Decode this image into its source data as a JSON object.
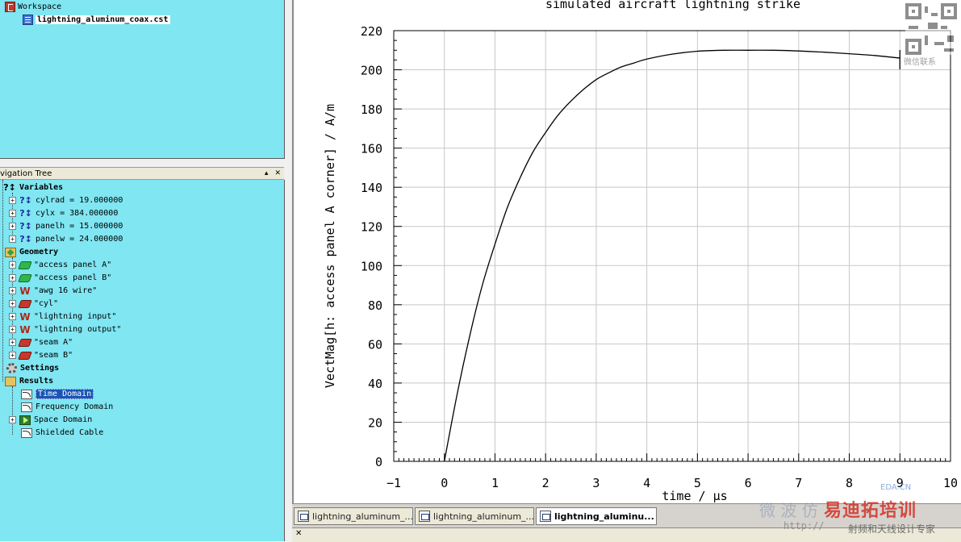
{
  "workspace": {
    "title": "Workspace",
    "project_file": "lightning_aluminum_coax.cst"
  },
  "nav_tree": {
    "title": "vigation Tree",
    "pin_glyph": "▴",
    "close_glyph": "✕",
    "variables": {
      "label": "Variables",
      "items": [
        "cylrad = 19.000000",
        "cylx = 384.000000",
        "panelh = 15.000000",
        "panelw = 24.000000"
      ]
    },
    "geometry": {
      "label": "Geometry",
      "items": [
        {
          "name": "\"access panel A\"",
          "icon": "brick-green-icon"
        },
        {
          "name": "\"access panel B\"",
          "icon": "brick-green-icon"
        },
        {
          "name": "\"awg 16 wire\"",
          "icon": "wire-icon"
        },
        {
          "name": "\"cyl\"",
          "icon": "brick-red-icon"
        },
        {
          "name": "\"lightning input\"",
          "icon": "wire-icon"
        },
        {
          "name": "\"lightning output\"",
          "icon": "wire-icon"
        },
        {
          "name": "\"seam A\"",
          "icon": "brick-red-icon"
        },
        {
          "name": "\"seam B\"",
          "icon": "brick-red-icon"
        }
      ]
    },
    "settings": {
      "label": "Settings"
    },
    "results": {
      "label": "Results",
      "items": [
        "Time Domain",
        "Frequency Domain",
        "Space Domain",
        "Shielded Cable"
      ],
      "selected": "Time Domain"
    }
  },
  "tabs": [
    {
      "label": "lightning_aluminum_...",
      "active": false
    },
    {
      "label": "lightning_aluminum_...",
      "active": false
    },
    {
      "label": "lightning_aluminu...",
      "active": true
    }
  ],
  "bottom_strip": {
    "close_glyph": "✕"
  },
  "watermark": {
    "eda": "EDA.CN",
    "grey": "微 波 仿",
    "red": "易迪拓培训",
    "url": "http://",
    "sub": "射频和天线设计专家",
    "qr_label": "微信联系"
  },
  "chart_data": {
    "type": "line",
    "title": "simulated aircraft lightning strike",
    "xlabel": "time / μs",
    "ylabel": "VectMag[h: access panel A corner] / A/m",
    "xlim": [
      -1,
      10
    ],
    "ylim": [
      0,
      220
    ],
    "xticks": [
      -1,
      0,
      1,
      2,
      3,
      4,
      5,
      6,
      7,
      8,
      9,
      10
    ],
    "yticks": [
      0,
      20,
      40,
      60,
      80,
      100,
      120,
      140,
      160,
      180,
      200,
      220
    ],
    "grid": true,
    "series": [
      {
        "x": [
          0,
          0.25,
          0.5,
          0.75,
          1,
          1.25,
          1.5,
          1.75,
          2,
          2.25,
          2.5,
          2.75,
          3,
          3.25,
          3.5,
          3.75,
          4,
          4.5,
          5,
          5.5,
          6,
          6.5,
          7,
          7.5,
          8,
          8.5,
          9
        ],
        "y": [
          0,
          34,
          64,
          90,
          111,
          130,
          145,
          158,
          168,
          177,
          184,
          190,
          195,
          198.5,
          201.5,
          203.5,
          205.5,
          208,
          209.5,
          210,
          210,
          210,
          209.6,
          209,
          208.2,
          207.3,
          206
        ]
      }
    ],
    "marker": {
      "x": 9,
      "y": 206
    }
  }
}
